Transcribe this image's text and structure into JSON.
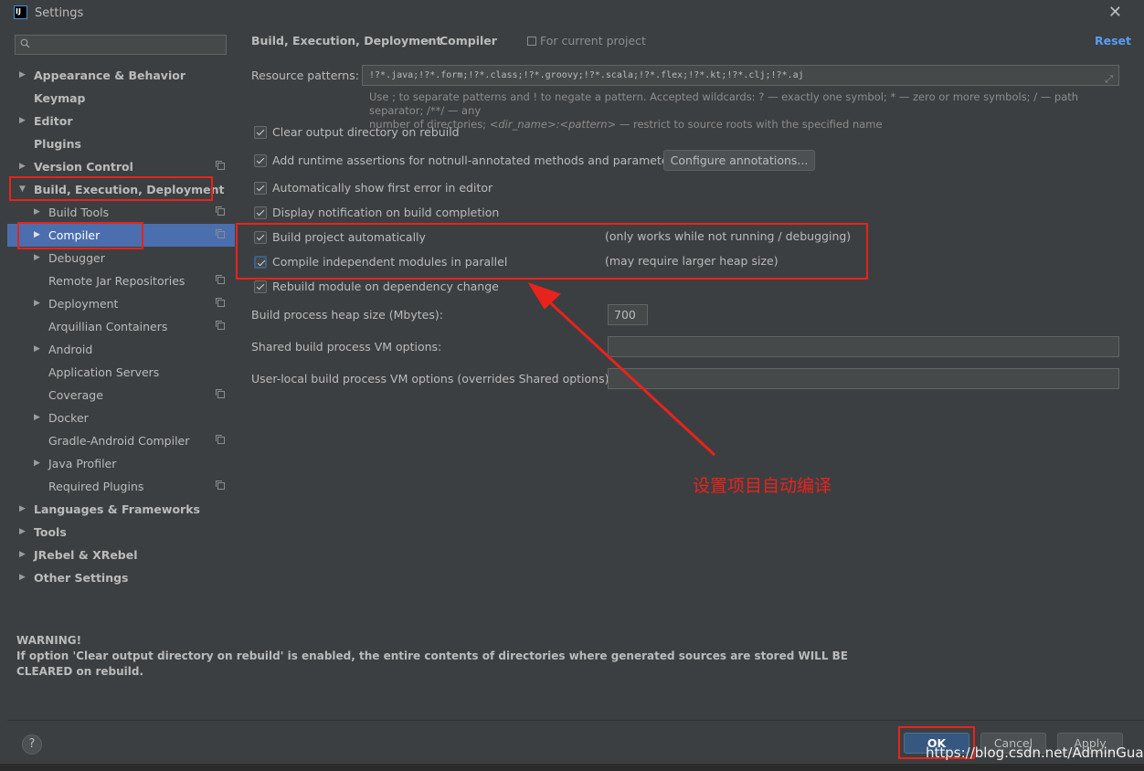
{
  "window": {
    "title": "Settings",
    "app_icon": "IJ"
  },
  "sidebar": {
    "search_placeholder": "",
    "items": [
      {
        "label": "Appearance & Behavior",
        "level": 0,
        "arrow": "right",
        "bold": true
      },
      {
        "label": "Keymap",
        "level": 0,
        "arrow": "",
        "bold": true
      },
      {
        "label": "Editor",
        "level": 0,
        "arrow": "right",
        "bold": true
      },
      {
        "label": "Plugins",
        "level": 0,
        "arrow": "",
        "bold": true
      },
      {
        "label": "Version Control",
        "level": 0,
        "arrow": "right",
        "bold": true,
        "icon": "copy-icon"
      },
      {
        "label": "Build, Execution, Deployment",
        "level": 0,
        "arrow": "down",
        "bold": true
      },
      {
        "label": "Build Tools",
        "level": 1,
        "arrow": "right",
        "icon": "copy-icon"
      },
      {
        "label": "Compiler",
        "level": 1,
        "arrow": "right",
        "selected": true,
        "icon": "copy-icon"
      },
      {
        "label": "Debugger",
        "level": 1,
        "arrow": "right"
      },
      {
        "label": "Remote Jar Repositories",
        "level": 1,
        "arrow": "",
        "icon": "copy-icon"
      },
      {
        "label": "Deployment",
        "level": 1,
        "arrow": "right",
        "icon": "copy-icon"
      },
      {
        "label": "Arquillian Containers",
        "level": 1,
        "arrow": "",
        "icon": "copy-icon"
      },
      {
        "label": "Android",
        "level": 1,
        "arrow": "right"
      },
      {
        "label": "Application Servers",
        "level": 1,
        "arrow": ""
      },
      {
        "label": "Coverage",
        "level": 1,
        "arrow": "",
        "icon": "copy-icon"
      },
      {
        "label": "Docker",
        "level": 1,
        "arrow": "right"
      },
      {
        "label": "Gradle-Android Compiler",
        "level": 1,
        "arrow": "",
        "icon": "copy-icon"
      },
      {
        "label": "Java Profiler",
        "level": 1,
        "arrow": "right"
      },
      {
        "label": "Required Plugins",
        "level": 1,
        "arrow": "",
        "icon": "copy-icon"
      },
      {
        "label": "Languages & Frameworks",
        "level": 0,
        "arrow": "right",
        "bold": true
      },
      {
        "label": "Tools",
        "level": 0,
        "arrow": "right",
        "bold": true
      },
      {
        "label": "JRebel & XRebel",
        "level": 0,
        "arrow": "right",
        "bold": true
      },
      {
        "label": "Other Settings",
        "level": 0,
        "arrow": "right",
        "bold": true
      }
    ]
  },
  "header": {
    "crumb1": "Build, Execution, Deployment",
    "sep": "›",
    "crumb2": "Compiler",
    "scope": "For current project",
    "reset": "Reset"
  },
  "resource": {
    "label": "Resource patterns:",
    "value": "!?*.java;!?*.form;!?*.class;!?*.groovy;!?*.scala;!?*.flex;!?*.kt;!?*.clj;!?*.aj",
    "hint_line1": "Use ; to separate patterns and ! to negate a pattern. Accepted wildcards: ? — exactly one symbol; * — zero or more symbols; / — path separator; /**/ — any",
    "hint_line2a": "number of directories; ",
    "hint_line2b": "<dir_name>:<pattern>",
    "hint_line2c": " — restrict to source roots with the specified name"
  },
  "options": {
    "clear_output": "Clear output directory on rebuild",
    "runtime_assertions": "Add runtime assertions for notnull-annotated methods and parameters",
    "configure_annotations": "Configure annotations...",
    "show_first_error": "Automatically show first error in editor",
    "display_notification": "Display notification on build completion",
    "build_auto": "Build project automatically",
    "build_auto_note": "(only works while not running / debugging)",
    "compile_parallel": "Compile independent modules in parallel",
    "compile_parallel_note": "(may require larger heap size)",
    "rebuild_module": "Rebuild module on dependency change"
  },
  "vm": {
    "heap_label": "Build process heap size (Mbytes):",
    "heap_value": "700",
    "shared_label": "Shared build process VM options:",
    "shared_value": "",
    "user_label": "User-local build process VM options (overrides Shared options):",
    "user_value": ""
  },
  "warning": {
    "title": "WARNING!",
    "text": "If option 'Clear output directory on rebuild' is enabled, the entire contents of directories where generated sources are stored WILL BE CLEARED on rebuild."
  },
  "annotation": {
    "text": "设置项目自动编译",
    "color": "#e8231c"
  },
  "footer": {
    "help": "?",
    "ok": "OK",
    "cancel": "Cancel",
    "apply": "Apply"
  },
  "watermark": "https://blog.csdn.net/AdminGuan",
  "colors": {
    "background": "#3c3f41",
    "selection": "#4b6eaf",
    "link": "#589df6",
    "highlight": "#e8231c"
  }
}
